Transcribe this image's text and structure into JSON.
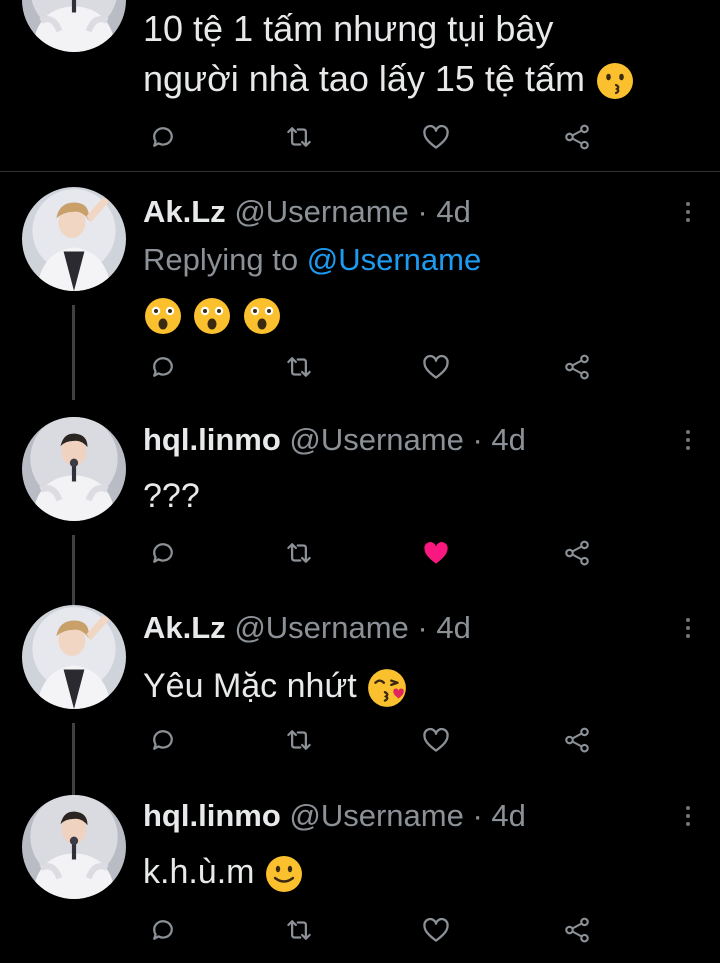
{
  "top_tweet": {
    "text_line1": "10 tệ 1 tấm nhưng tụi bây",
    "text_line2": "người nhà tao lấy 15 tệ  tấm",
    "emoji": "hushed-face"
  },
  "tweets": [
    {
      "name": "Ak.Lz",
      "handle": "@Username",
      "sep": " · ",
      "time": "4d",
      "replying_label": "Replying to ",
      "replying_handle": "@Username",
      "text": "",
      "emojis": [
        "astonished-face",
        "astonished-face",
        "astonished-face"
      ],
      "liked": false
    },
    {
      "name": "hql.linmo",
      "handle": "@Username",
      "sep": " · ",
      "time": "4d",
      "text": "???",
      "liked": true
    },
    {
      "name": "Ak.Lz",
      "handle": "@Username",
      "sep": " · ",
      "time": "4d",
      "text": "Yêu Mặc nhứt ",
      "emoji": "face-blowing-kiss",
      "liked": false
    },
    {
      "name": "hql.linmo",
      "handle": "@Username",
      "sep": " · ",
      "time": "4d",
      "text": "k.h.ù.m ",
      "emoji": "slightly-smiling-face",
      "liked": false
    }
  ],
  "colors": {
    "background": "#000000",
    "text": "#e7e9ea",
    "secondary": "#8b9196",
    "mention": "#1d9bf0",
    "like_active": "#f91880",
    "emoji": "#fbc02d"
  }
}
